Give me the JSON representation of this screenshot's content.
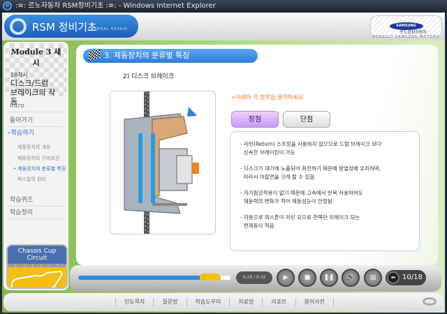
{
  "window": {
    "title": ":≡: 르노자동차 RSM정비기초 :≡: - Windows Internet Explorer"
  },
  "header": {
    "app_title": "RSM 정비기초",
    "app_subtitle": "GENERAL REPAIR",
    "brand_logo": "SAMSUNG",
    "brand_korean": "르노삼성자동차",
    "brand_english": "RENAULT SAMSUNG MOTORS"
  },
  "sidebar": {
    "module": "Module 3 섀시",
    "lesson_no": "18차시",
    "lesson_title_1": "디스크/드럼",
    "lesson_title_2": "브레이크의 작동",
    "nav": [
      {
        "label": "Intro"
      },
      {
        "label": "들어가기"
      },
      {
        "label": "학습하기"
      },
      {
        "label": "학습퀴즈"
      },
      {
        "label": "학습정리"
      }
    ],
    "sub": [
      {
        "label": "제동장치의 개요"
      },
      {
        "label": "제동장치의 구비조건"
      },
      {
        "label": "제동장치의 분류별 특징"
      },
      {
        "label": "파스칼의 원리"
      }
    ],
    "circuit": {
      "title": "Chassis Cup Circuit",
      "current": "18"
    }
  },
  "main": {
    "section_title": "3. 제동장치의 분류별 특징",
    "subheading": "2) 디스크 브레이크",
    "instruction": ">아래의 각 항목을 클릭하세요.",
    "tabs": [
      {
        "label": "장점"
      },
      {
        "label": "단점"
      }
    ],
    "items": [
      {
        "line1": "- 리턴(Return) 스프링을 사용하지 않으므로 드럼 브레이크 보다",
        "line2": "신속한 브레이킹이 가능"
      },
      {
        "line1": "- 디스크가 대기에 노출되어 회전하기 때문에 방열성에 유리하며,",
        "line2": "따라서 마찰면을 크게 할 수 있음"
      },
      {
        "line1": "- 자기잠금작용이 없기 때문에 고속에서 반복 사용하여도",
        "line2": "제동력의 변화가 적어 제동성능이 안정됨"
      },
      {
        "line1": "- 자동으로 피스톤이 리턴 되므로 한쪽만 브레이크 되는",
        "line2": "편제동이 적음"
      }
    ]
  },
  "player": {
    "time": "0:29 / 0:32",
    "progress": 0.9,
    "page": "10/18"
  },
  "footer": {
    "links": [
      "진도목차",
      "질문방",
      "학습도우미",
      "자료방",
      "리포트",
      "용어사전"
    ]
  },
  "colors": {
    "accent": "#2b7fd8",
    "instruction": "#f07a20",
    "green_bg": "#9fcd6a"
  }
}
